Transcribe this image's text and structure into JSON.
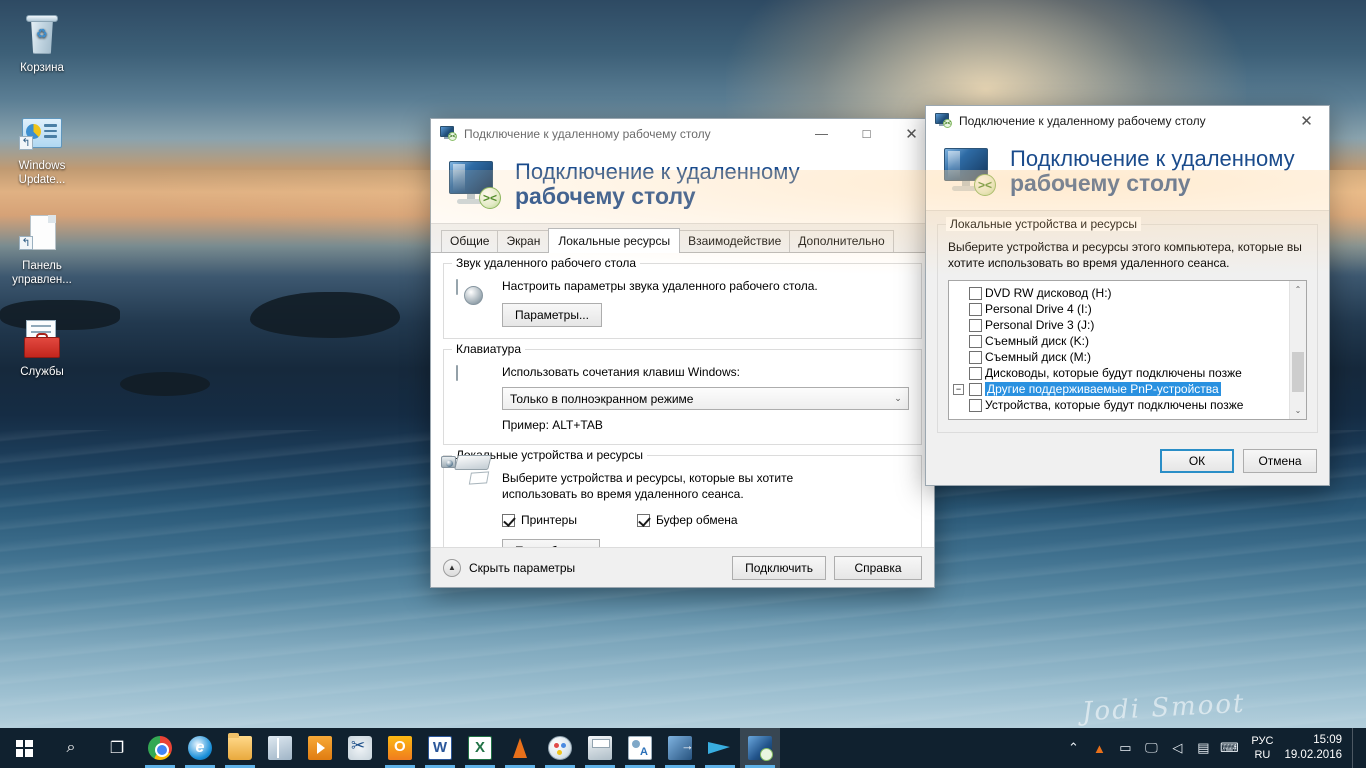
{
  "desktop": {
    "icons": [
      {
        "name": "recycle-bin",
        "label": "Корзина"
      },
      {
        "name": "windows-update",
        "label": "Windows Update..."
      },
      {
        "name": "control-panel",
        "label": "Панель управлен..."
      },
      {
        "name": "services",
        "label": "Службы"
      }
    ],
    "signature": "Jodi Smoot"
  },
  "window_main": {
    "title": "Подключение к удаленному рабочему столу",
    "banner_line1": "Подключение к удаленному",
    "banner_line2": "рабочему столу",
    "controls": {
      "minimize": "—",
      "maximize": "□",
      "close": "✕"
    },
    "tabs": [
      {
        "label": "Общие",
        "selected": false
      },
      {
        "label": "Экран",
        "selected": false
      },
      {
        "label": "Локальные ресурсы",
        "selected": true
      },
      {
        "label": "Взаимодействие",
        "selected": false
      },
      {
        "label": "Дополнительно",
        "selected": false
      }
    ],
    "group_audio": {
      "legend": "Звук удаленного рабочего стола",
      "text": "Настроить параметры звука удаленного рабочего стола.",
      "button": "Параметры..."
    },
    "group_keyboard": {
      "legend": "Клавиатура",
      "text": "Использовать сочетания клавиш Windows:",
      "combo_value": "Только в полноэкранном режиме",
      "combo_arrow": "⌄",
      "example": "Пример: ALT+TAB"
    },
    "group_devices": {
      "legend": "Локальные устройства и ресурсы",
      "text_line1": "Выберите устройства и ресурсы, которые вы хотите",
      "text_line2": "использовать во время удаленного сеанса.",
      "checkboxes": [
        {
          "label": "Принтеры",
          "checked": true
        },
        {
          "label": "Буфер обмена",
          "checked": true
        }
      ],
      "button": "Подробнее..."
    },
    "footer": {
      "hide_options": "Скрыть параметры",
      "connect": "Подключить",
      "help": "Справка"
    }
  },
  "window_dialog": {
    "title": "Подключение к удаленному рабочему столу",
    "banner_line1": "Подключение к удаленному",
    "banner_line2": "рабочему столу",
    "close": "✕",
    "group_legend": "Локальные устройства и ресурсы",
    "description_line1": "Выберите устройства и ресурсы этого компьютера, которые вы",
    "description_line2": "хотите использовать во время удаленного сеанса.",
    "list_items": [
      {
        "label": "DVD RW дисковод (H:)",
        "checked": false,
        "indent": true,
        "expander": null,
        "selected": false
      },
      {
        "label": "Personal Drive 4 (I:)",
        "checked": false,
        "indent": true,
        "expander": null,
        "selected": false
      },
      {
        "label": "Personal Drive 3 (J:)",
        "checked": false,
        "indent": true,
        "expander": null,
        "selected": false
      },
      {
        "label": "Съемный диск (K:)",
        "checked": false,
        "indent": true,
        "expander": null,
        "selected": false
      },
      {
        "label": "Съемный диск (M:)",
        "checked": false,
        "indent": true,
        "expander": null,
        "selected": false
      },
      {
        "label": "Дисководы, которые будут подключены позже",
        "checked": false,
        "indent": true,
        "expander": null,
        "selected": false
      },
      {
        "label": "Другие поддерживаемые PnP-устройства",
        "checked": false,
        "indent": false,
        "expander": "−",
        "selected": true
      },
      {
        "label": "Устройства, которые будут подключены позже",
        "checked": false,
        "indent": true,
        "expander": null,
        "selected": false
      }
    ],
    "scroll": {
      "up": "⌃",
      "down": "⌄"
    },
    "buttons": {
      "ok": "ОК",
      "cancel": "Отмена"
    }
  },
  "taskbar": {
    "start": "start-button",
    "search_icon": "⌕",
    "taskview_icon": "❐",
    "apps": [
      {
        "name": "chrome",
        "cls": "a-chrome",
        "glyph": "",
        "running": true,
        "active": false
      },
      {
        "name": "internet-explorer",
        "cls": "a-ie",
        "glyph": "e",
        "running": true,
        "active": false
      },
      {
        "name": "file-explorer",
        "cls": "a-folder",
        "glyph": "",
        "running": true,
        "active": false
      },
      {
        "name": "store",
        "cls": "a-store",
        "glyph": "",
        "running": false,
        "active": false
      },
      {
        "name": "media-player",
        "cls": "a-media",
        "glyph": "",
        "running": false,
        "active": false
      },
      {
        "name": "snipping-tool",
        "cls": "a-snip",
        "glyph": "",
        "running": false,
        "active": false
      },
      {
        "name": "outlook",
        "cls": "a-outlook",
        "glyph": "",
        "running": true,
        "active": false
      },
      {
        "name": "word",
        "cls": "a-word",
        "glyph": "W",
        "running": true,
        "active": false
      },
      {
        "name": "excel",
        "cls": "a-excel",
        "glyph": "X",
        "running": true,
        "active": false
      },
      {
        "name": "vlc",
        "cls": "a-vlc",
        "glyph": "",
        "running": true,
        "active": false
      },
      {
        "name": "paint",
        "cls": "a-paint",
        "glyph": "",
        "running": true,
        "active": false
      },
      {
        "name": "scanner",
        "cls": "a-scanner",
        "glyph": "",
        "running": true,
        "active": false
      },
      {
        "name": "contacts",
        "cls": "a-contact",
        "glyph": "",
        "running": true,
        "active": false
      },
      {
        "name": "logoff",
        "cls": "a-logoff",
        "glyph": "",
        "running": true,
        "active": false
      },
      {
        "name": "telegram",
        "cls": "a-tg",
        "glyph": "",
        "running": true,
        "active": false
      },
      {
        "name": "remote-desktop",
        "cls": "a-rdp",
        "glyph": "",
        "running": true,
        "active": true
      }
    ],
    "tray": {
      "chevron": "⌃",
      "icons": [
        {
          "name": "vlc-tray-icon",
          "glyph": "▲"
        },
        {
          "name": "battery-icon",
          "glyph": "▭"
        },
        {
          "name": "network-icon",
          "glyph": "🖵"
        },
        {
          "name": "volume-icon",
          "glyph": "◁"
        },
        {
          "name": "action-center-icon",
          "glyph": "▤"
        },
        {
          "name": "touch-keyboard-icon",
          "glyph": "⌨"
        }
      ],
      "lang_line1": "РУС",
      "lang_line2": "RU",
      "time": "15:09",
      "date": "19.02.2016"
    }
  }
}
